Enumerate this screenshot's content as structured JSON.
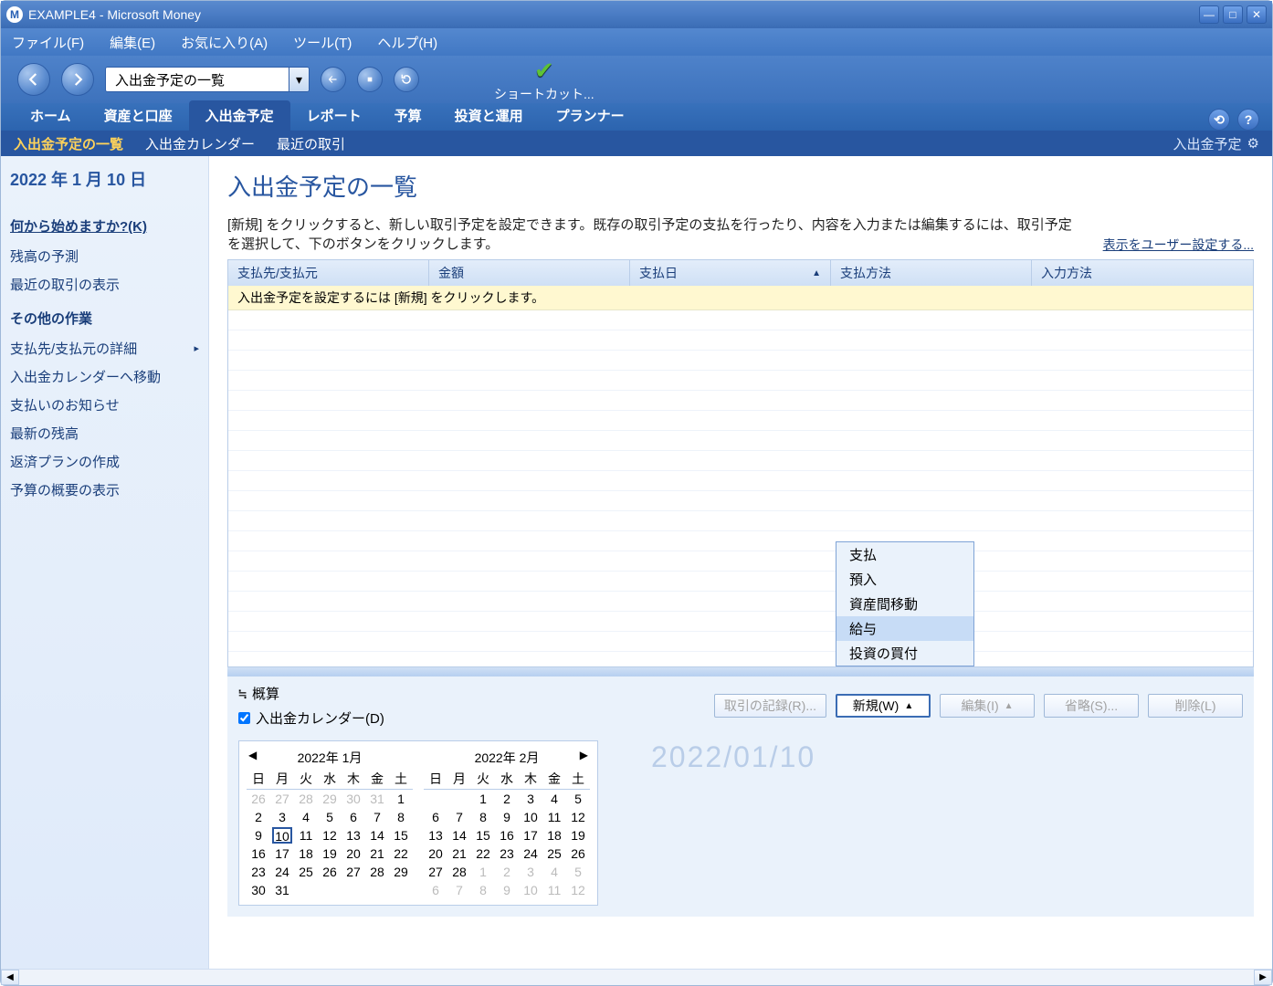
{
  "window": {
    "title": "EXAMPLE4 - Microsoft Money"
  },
  "menubar": {
    "file": "ファイル(F)",
    "edit": "編集(E)",
    "fav": "お気に入り(A)",
    "tools": "ツール(T)",
    "help": "ヘルプ(H)"
  },
  "navbar": {
    "combo_value": "入出金予定の一覧",
    "shortcut_label": "ショートカット..."
  },
  "tabs": {
    "home": "ホーム",
    "assets": "資産と口座",
    "schedule": "入出金予定",
    "report": "レポート",
    "budget": "予算",
    "invest": "投資と運用",
    "planner": "プランナー"
  },
  "subtabs": {
    "list": "入出金予定の一覧",
    "calendar": "入出金カレンダー",
    "recent": "最近の取引",
    "right_label": "入出金予定"
  },
  "sidebar": {
    "date": "2022 年 1 月 10 日",
    "start_header": "何から始めますか?(K)",
    "start_items": [
      "残高の予測",
      "最近の取引の表示"
    ],
    "other_header": "その他の作業",
    "other_items": [
      "支払先/支払元の詳細",
      "入出金カレンダーへ移動",
      "支払いのお知らせ",
      "最新の残高",
      "返済プランの作成",
      "予算の概要の表示"
    ]
  },
  "main": {
    "title": "入出金予定の一覧",
    "desc": "[新規] をクリックすると、新しい取引予定を設定できます。既存の取引予定の支払を行ったり、内容を入力または編集するには、取引予定を選択して、下のボタンをクリックします。",
    "config_link": "表示をユーザー設定する...",
    "columns": {
      "payee": "支払先/支払元",
      "amount": "金額",
      "date": "支払日",
      "method": "支払方法",
      "input": "入力方法"
    },
    "hint": "入出金予定を設定するには [新規] をクリックします。"
  },
  "popup": {
    "items": [
      "支払",
      "預入",
      "資産間移動",
      "給与",
      "投資の買付"
    ],
    "highlight_index": 3
  },
  "lower": {
    "approx": "概算",
    "calendar_chk": "入出金カレンダー(D)",
    "record": "取引の記録(R)...",
    "new": "新規(W)",
    "edit": "編集(I)",
    "skip": "省略(S)...",
    "delete": "削除(L)"
  },
  "cal": {
    "month1_title": "2022年 1月",
    "month2_title": "2022年 2月",
    "dow": [
      "日",
      "月",
      "火",
      "水",
      "木",
      "金",
      "土"
    ],
    "m1": [
      [
        {
          "d": 26,
          "dim": true
        },
        {
          "d": 27,
          "dim": true
        },
        {
          "d": 28,
          "dim": true
        },
        {
          "d": 29,
          "dim": true
        },
        {
          "d": 30,
          "dim": true
        },
        {
          "d": 31,
          "dim": true
        },
        {
          "d": 1
        }
      ],
      [
        {
          "d": 2
        },
        {
          "d": 3
        },
        {
          "d": 4
        },
        {
          "d": 5
        },
        {
          "d": 6
        },
        {
          "d": 7
        },
        {
          "d": 8
        }
      ],
      [
        {
          "d": 9
        },
        {
          "d": 10,
          "today": true
        },
        {
          "d": 11
        },
        {
          "d": 12
        },
        {
          "d": 13
        },
        {
          "d": 14
        },
        {
          "d": 15
        }
      ],
      [
        {
          "d": 16
        },
        {
          "d": 17
        },
        {
          "d": 18
        },
        {
          "d": 19
        },
        {
          "d": 20
        },
        {
          "d": 21
        },
        {
          "d": 22
        }
      ],
      [
        {
          "d": 23
        },
        {
          "d": 24
        },
        {
          "d": 25
        },
        {
          "d": 26
        },
        {
          "d": 27
        },
        {
          "d": 28
        },
        {
          "d": 29
        }
      ],
      [
        {
          "d": 30
        },
        {
          "d": 31
        },
        {
          "d": "",
          "dim": true
        },
        {
          "d": "",
          "dim": true
        },
        {
          "d": "",
          "dim": true
        },
        {
          "d": "",
          "dim": true
        },
        {
          "d": "",
          "dim": true
        }
      ]
    ],
    "m2": [
      [
        {
          "d": "",
          "dim": true
        },
        {
          "d": "",
          "dim": true
        },
        {
          "d": 1
        },
        {
          "d": 2
        },
        {
          "d": 3
        },
        {
          "d": 4
        },
        {
          "d": 5
        }
      ],
      [
        {
          "d": 6
        },
        {
          "d": 7
        },
        {
          "d": 8
        },
        {
          "d": 9
        },
        {
          "d": 10
        },
        {
          "d": 11
        },
        {
          "d": 12
        }
      ],
      [
        {
          "d": 13
        },
        {
          "d": 14
        },
        {
          "d": 15
        },
        {
          "d": 16
        },
        {
          "d": 17
        },
        {
          "d": 18
        },
        {
          "d": 19
        }
      ],
      [
        {
          "d": 20
        },
        {
          "d": 21
        },
        {
          "d": 22
        },
        {
          "d": 23
        },
        {
          "d": 24
        },
        {
          "d": 25
        },
        {
          "d": 26
        }
      ],
      [
        {
          "d": 27
        },
        {
          "d": 28
        },
        {
          "d": 1,
          "dim": true
        },
        {
          "d": 2,
          "dim": true
        },
        {
          "d": 3,
          "dim": true
        },
        {
          "d": 4,
          "dim": true
        },
        {
          "d": 5,
          "dim": true
        }
      ],
      [
        {
          "d": 6,
          "dim": true
        },
        {
          "d": 7,
          "dim": true
        },
        {
          "d": 8,
          "dim": true
        },
        {
          "d": 9,
          "dim": true
        },
        {
          "d": 10,
          "dim": true
        },
        {
          "d": 11,
          "dim": true
        },
        {
          "d": 12,
          "dim": true
        }
      ]
    ],
    "big_date": "2022/01/10"
  }
}
